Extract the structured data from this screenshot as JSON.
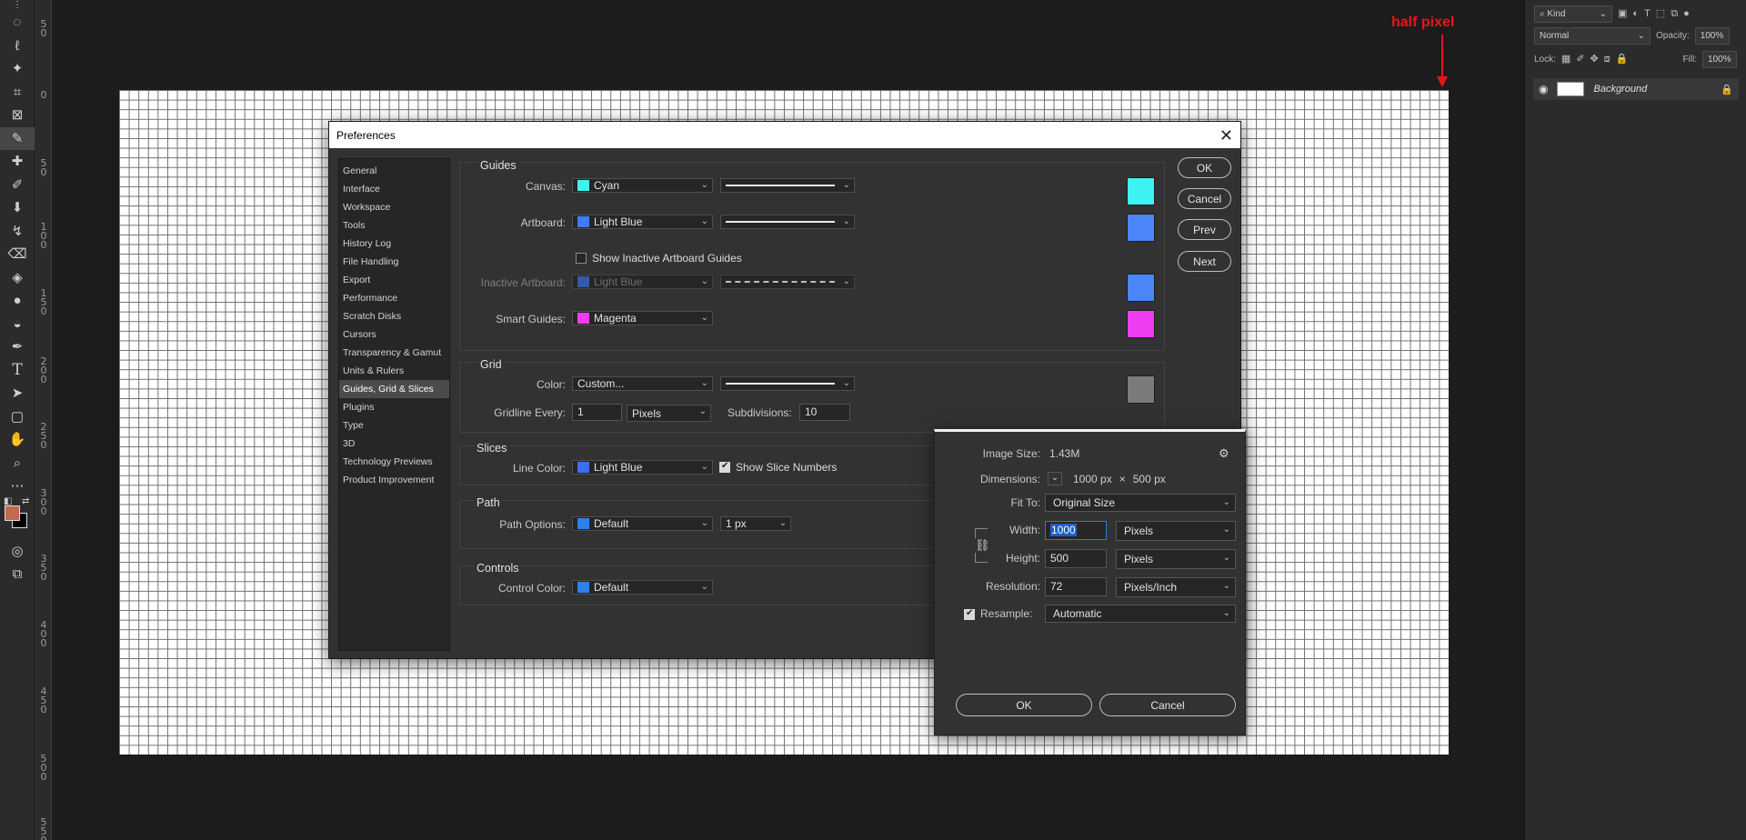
{
  "annotation": {
    "text": "half pixel",
    "color": "#e8161c"
  },
  "toolbar": {
    "tools": [
      "⌖",
      "◌",
      "ℓ",
      "✦",
      "⊞",
      "⊠",
      "✎",
      "✚",
      "✐",
      "⬇",
      "✂",
      "⌫",
      "◈",
      "💧",
      "◒",
      "✒",
      "T",
      "➤",
      "▢",
      "✋",
      "🔍",
      "⋯"
    ]
  },
  "ruler": {
    "labels": [
      "5\n0",
      "0",
      "5\n0",
      "1\n0\n0",
      "1\n5\n0",
      "2\n0\n0",
      "2\n5\n0",
      "3\n0\n0",
      "3\n5\n0",
      "4\n0\n0",
      "4\n5\n0",
      "5\n0\n0",
      "5\n5\n0"
    ]
  },
  "layers_panel": {
    "kind_label": "Kind",
    "blend_mode": "Normal",
    "opacity_label": "Opacity:",
    "opacity_value": "100%",
    "lock_label": "Lock:",
    "fill_label": "Fill:",
    "fill_value": "100%",
    "layer_name": "Background"
  },
  "preferences": {
    "title": "Preferences",
    "nav": [
      "General",
      "Interface",
      "Workspace",
      "Tools",
      "History Log",
      "File Handling",
      "Export",
      "Performance",
      "Scratch Disks",
      "Cursors",
      "Transparency & Gamut",
      "Units & Rulers",
      "Guides, Grid & Slices",
      "Plugins",
      "Type",
      "3D",
      "Technology Previews",
      "Product Improvement"
    ],
    "active_nav": "Guides, Grid & Slices",
    "guides": {
      "title": "Guides",
      "canvas_label": "Canvas:",
      "canvas_color": "Cyan",
      "canvas_swatch": "#3ef2f2",
      "artboard_label": "Artboard:",
      "artboard_color": "Light Blue",
      "artboard_swatch": "#3d7cf8",
      "show_inactive_label": "Show Inactive Artboard Guides",
      "inactive_label": "Inactive Artboard:",
      "inactive_color": "Light Blue",
      "smart_label": "Smart Guides:",
      "smart_color": "Magenta",
      "smart_swatch": "#f03cf0"
    },
    "grid": {
      "title": "Grid",
      "color_label": "Color:",
      "color_value": "Custom...",
      "grid_swatch": "#7b7b7b",
      "gridline_label": "Gridline Every:",
      "gridline_value": "1",
      "gridline_unit": "Pixels",
      "subdiv_label": "Subdivisions:",
      "subdiv_value": "10"
    },
    "slices": {
      "title": "Slices",
      "line_color_label": "Line Color:",
      "line_color": "Light Blue",
      "show_numbers_label": "Show Slice Numbers"
    },
    "path": {
      "title": "Path",
      "options_label": "Path Options:",
      "options_value": "Default",
      "width_value": "1 px"
    },
    "controls": {
      "title": "Controls",
      "color_label": "Control Color:",
      "color_value": "Default"
    },
    "buttons": {
      "ok": "OK",
      "cancel": "Cancel",
      "prev": "Prev",
      "next": "Next"
    }
  },
  "image_size": {
    "size_label": "Image Size:",
    "size_value": "1.43M",
    "dims_label": "Dimensions:",
    "dims_w": "1000 px",
    "dims_x": "×",
    "dims_h": "500 px",
    "fit_label": "Fit To:",
    "fit_value": "Original Size",
    "width_label": "Width:",
    "width_value": "1000",
    "width_unit": "Pixels",
    "height_label": "Height:",
    "height_value": "500",
    "height_unit": "Pixels",
    "res_label": "Resolution:",
    "res_value": "72",
    "res_unit": "Pixels/Inch",
    "resample_label": "Resample:",
    "resample_value": "Automatic",
    "ok": "OK",
    "cancel": "Cancel"
  }
}
